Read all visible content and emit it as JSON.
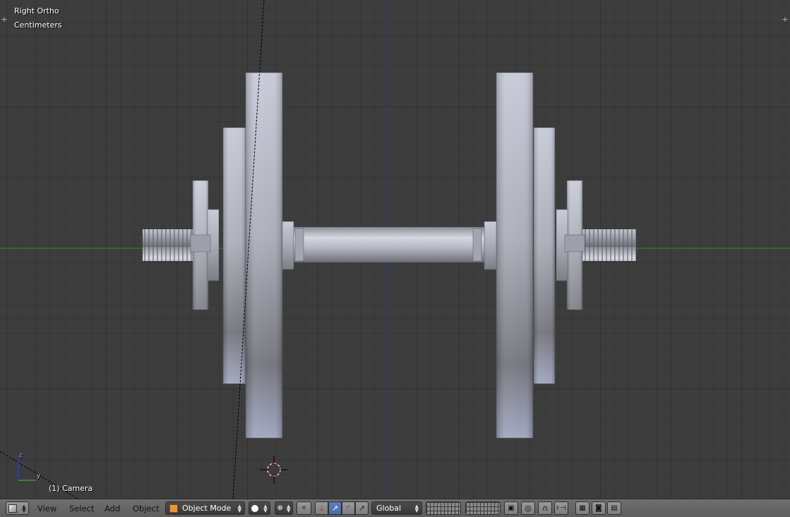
{
  "viewport": {
    "view_name": "Right Ortho",
    "units": "Centimeters",
    "object_label": "(1) Camera",
    "grid_color": "#3d3d3d",
    "y_axis_color": "#3b8a2e",
    "z_axis_color": "#2d3c9e"
  },
  "axes_gizmo": {
    "z_label": "z",
    "y_label": "y"
  },
  "header": {
    "menus": [
      "View",
      "Select",
      "Add",
      "Object"
    ],
    "mode": "Object Mode",
    "transform_orientation": "Global"
  }
}
